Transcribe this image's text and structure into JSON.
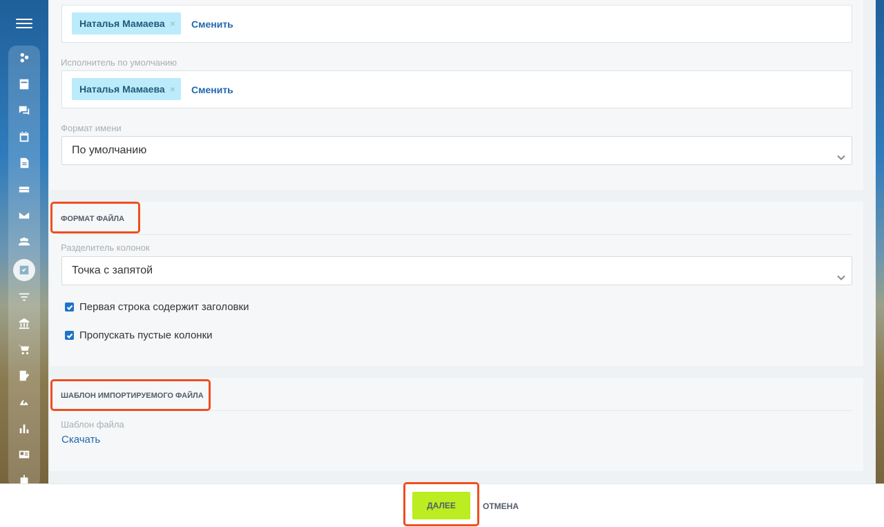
{
  "sidebar": {
    "menu_icon": "hamburger-icon",
    "icons": [
      "activity-stream-icon",
      "tasks-icon",
      "chat-icon",
      "calendar-icon",
      "documents-icon",
      "drive-icon",
      "mail-icon",
      "groups-icon",
      "crm-icon",
      "funnel-icon",
      "company-icon",
      "shop-icon",
      "forms-icon",
      "sign-icon",
      "reports-icon",
      "contacts-icon",
      "robot-icon"
    ]
  },
  "responsible": {
    "user_name": "Наталья Мамаева",
    "remove_symbol": "×",
    "change_label": "Сменить"
  },
  "default_executor": {
    "label": "Исполнитель по умолчанию",
    "user_name": "Наталья Мамаева",
    "remove_symbol": "×",
    "change_label": "Сменить"
  },
  "name_format": {
    "label": "Формат имени",
    "value": "По умолчанию"
  },
  "file_format": {
    "title": "ФОРМАТ ФАЙЛА",
    "separator_label": "Разделитель колонок",
    "separator_value": "Точка с запятой",
    "checkboxes": [
      {
        "label": "Первая строка содержит заголовки",
        "checked": true
      },
      {
        "label": "Пропускать пустые колонки",
        "checked": true
      }
    ]
  },
  "template": {
    "title": "ШАБЛОН ИМПОРТИРУЕМОГО ФАЙЛА",
    "label": "Шаблон файла",
    "download_label": "Скачать"
  },
  "footer": {
    "next_label": "ДАЛЕЕ",
    "cancel_label": "ОТМЕНА"
  },
  "colors": {
    "accent_button": "#bbed21",
    "link": "#2067b0",
    "highlight": "#ee4e1f",
    "chip_bg": "#bcecfb"
  }
}
